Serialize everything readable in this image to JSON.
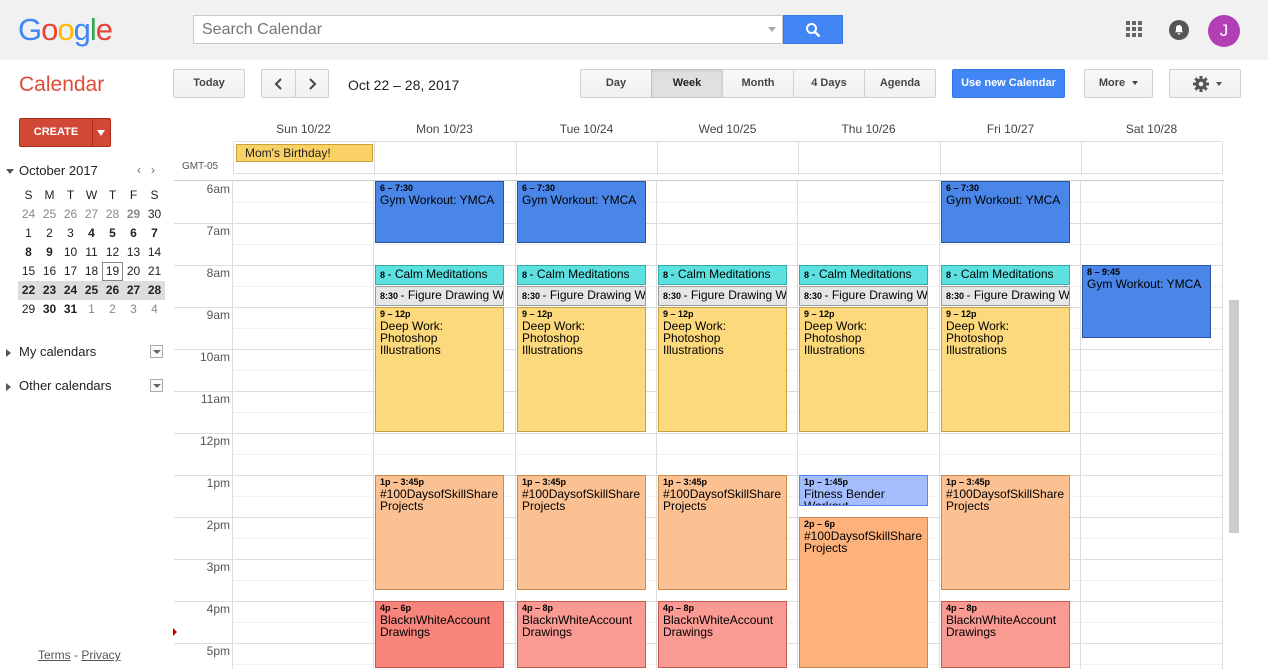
{
  "header": {
    "logo": [
      "G",
      "o",
      "o",
      "g",
      "l",
      "e"
    ],
    "logo_colors": [
      "#4285f4",
      "#ea4335",
      "#fbbc05",
      "#4285f4",
      "#34a853",
      "#ea4335"
    ],
    "search_placeholder": "Search Calendar",
    "avatar_letter": "J"
  },
  "toolbar": {
    "app_title": "Calendar",
    "today": "Today",
    "date_range": "Oct 22 – 28, 2017",
    "views": [
      "Day",
      "Week",
      "Month",
      "4 Days",
      "Agenda"
    ],
    "active_view": "Week",
    "new_calendar": "Use new Calendar",
    "more": "More"
  },
  "sidebar": {
    "create": "CREATE",
    "month_title": "October 2017",
    "weekdays": [
      "S",
      "M",
      "T",
      "W",
      "T",
      "F",
      "S"
    ],
    "weeks": [
      [
        "24",
        "25",
        "26",
        "27",
        "28",
        "29",
        "30"
      ],
      [
        "1",
        "2",
        "3",
        "4",
        "5",
        "6",
        "7"
      ],
      [
        "8",
        "9",
        "10",
        "11",
        "12",
        "13",
        "14"
      ],
      [
        "15",
        "16",
        "17",
        "18",
        "19",
        "20",
        "21"
      ],
      [
        "22",
        "23",
        "24",
        "25",
        "26",
        "27",
        "28"
      ],
      [
        "29",
        "30",
        "31",
        "1",
        "2",
        "3",
        "4"
      ]
    ],
    "my_calendars": "My calendars",
    "other_calendars": "Other calendars",
    "terms": "Terms",
    "privacy": "Privacy"
  },
  "calendar": {
    "timezone": "GMT-05",
    "days": [
      "Sun 10/22",
      "Mon 10/23",
      "Tue 10/24",
      "Wed 10/25",
      "Thu 10/26",
      "Fri 10/27",
      "Sat 10/28"
    ],
    "hours": [
      "6am",
      "7am",
      "8am",
      "9am",
      "10am",
      "11am",
      "12pm",
      "1pm",
      "2pm",
      "3pm",
      "4pm",
      "5pm"
    ],
    "all_day": [
      {
        "day": 0,
        "title": "Mom's Birthday!",
        "color": "#fad165"
      }
    ],
    "events": [
      {
        "day": 1,
        "start": 6,
        "end": 7.5,
        "time": "6 – 7:30",
        "title": "Gym Workout: YMCA",
        "bg": "#4986e7",
        "border": "#2952a3",
        "fg": "#000"
      },
      {
        "day": 2,
        "start": 6,
        "end": 7.5,
        "time": "6 – 7:30",
        "title": "Gym Workout: YMCA",
        "bg": "#4986e7",
        "border": "#2952a3",
        "fg": "#000"
      },
      {
        "day": 5,
        "start": 6,
        "end": 7.5,
        "time": "6 – 7:30",
        "title": "Gym Workout: YMCA",
        "bg": "#4986e7",
        "border": "#2952a3",
        "fg": "#000"
      },
      {
        "day": 1,
        "start": 8,
        "end": 8.5,
        "time": "8",
        "title": "- Calm Meditations",
        "bg": "#5ce0e0",
        "border": "#3aa",
        "fg": "#000",
        "one": true
      },
      {
        "day": 2,
        "start": 8,
        "end": 8.5,
        "time": "8",
        "title": "- Calm Meditations",
        "bg": "#5ce0e0",
        "border": "#3aa",
        "fg": "#000",
        "one": true
      },
      {
        "day": 3,
        "start": 8,
        "end": 8.5,
        "time": "8",
        "title": "- Calm Meditations",
        "bg": "#5ce0e0",
        "border": "#3aa",
        "fg": "#000",
        "one": true
      },
      {
        "day": 4,
        "start": 8,
        "end": 8.5,
        "time": "8",
        "title": "- Calm Meditations",
        "bg": "#5ce0e0",
        "border": "#3aa",
        "fg": "#000",
        "one": true
      },
      {
        "day": 5,
        "start": 8,
        "end": 8.5,
        "time": "8",
        "title": "- Calm Meditations",
        "bg": "#5ce0e0",
        "border": "#3aa",
        "fg": "#000",
        "one": true
      },
      {
        "day": 6,
        "start": 8,
        "end": 9.75,
        "time": "8 – 9:45",
        "title": "Gym Workout: YMCA",
        "bg": "#4986e7",
        "border": "#2952a3",
        "fg": "#000"
      },
      {
        "day": 1,
        "start": 8.5,
        "end": 9,
        "time": "8:30",
        "title": "- Figure Drawing Workshop",
        "bg": "#e6e6e6",
        "border": "#999",
        "fg": "#000",
        "one": true
      },
      {
        "day": 2,
        "start": 8.5,
        "end": 9,
        "time": "8:30",
        "title": "- Figure Drawing Workshop",
        "bg": "#e6e6e6",
        "border": "#999",
        "fg": "#000",
        "one": true
      },
      {
        "day": 3,
        "start": 8.5,
        "end": 9,
        "time": "8:30",
        "title": "- Figure Drawing Workshop",
        "bg": "#e6e6e6",
        "border": "#999",
        "fg": "#000",
        "one": true
      },
      {
        "day": 4,
        "start": 8.5,
        "end": 9,
        "time": "8:30",
        "title": "- Figure Drawing Workshop",
        "bg": "#e6e6e6",
        "border": "#999",
        "fg": "#000",
        "one": true
      },
      {
        "day": 5,
        "start": 8.5,
        "end": 9,
        "time": "8:30",
        "title": "- Figure Drawing Workshop",
        "bg": "#e6e6e6",
        "border": "#999",
        "fg": "#000",
        "one": true
      },
      {
        "day": 1,
        "start": 9,
        "end": 12,
        "time": "9 – 12p",
        "title": "Deep Work: Photoshop Illustrations",
        "bg": "#fbd97c",
        "border": "#c9a13a",
        "fg": "#000"
      },
      {
        "day": 2,
        "start": 9,
        "end": 12,
        "time": "9 – 12p",
        "title": "Deep Work: Photoshop Illustrations",
        "bg": "#fbd97c",
        "border": "#c9a13a",
        "fg": "#000"
      },
      {
        "day": 3,
        "start": 9,
        "end": 12,
        "time": "9 – 12p",
        "title": "Deep Work: Photoshop Illustrations",
        "bg": "#fbd97c",
        "border": "#c9a13a",
        "fg": "#000"
      },
      {
        "day": 4,
        "start": 9,
        "end": 12,
        "time": "9 – 12p",
        "title": "Deep Work: Photoshop Illustrations",
        "bg": "#fbd97c",
        "border": "#c9a13a",
        "fg": "#000"
      },
      {
        "day": 5,
        "start": 9,
        "end": 12,
        "time": "9 – 12p",
        "title": "Deep Work: Photoshop Illustrations",
        "bg": "#fbd97c",
        "border": "#c9a13a",
        "fg": "#000"
      },
      {
        "day": 1,
        "start": 13,
        "end": 15.75,
        "time": "1p – 3:45p",
        "title": "#100DaysofSkillShare Projects",
        "bg": "#fcc193",
        "border": "#c98a4a",
        "fg": "#000"
      },
      {
        "day": 2,
        "start": 13,
        "end": 15.75,
        "time": "1p – 3:45p",
        "title": "#100DaysofSkillShare Projects",
        "bg": "#fcc193",
        "border": "#c98a4a",
        "fg": "#000"
      },
      {
        "day": 3,
        "start": 13,
        "end": 15.75,
        "time": "1p – 3:45p",
        "title": "#100DaysofSkillShare Projects",
        "bg": "#fcc193",
        "border": "#c98a4a",
        "fg": "#000"
      },
      {
        "day": 4,
        "start": 13,
        "end": 13.75,
        "time": "1p – 1:45p",
        "title": "Fitness Bender Workout",
        "bg": "#a4bdfc",
        "border": "#5484ed",
        "fg": "#000"
      },
      {
        "day": 5,
        "start": 13,
        "end": 15.75,
        "time": "1p – 3:45p",
        "title": "#100DaysofSkillShare Projects",
        "bg": "#fcc193",
        "border": "#c98a4a",
        "fg": "#000"
      },
      {
        "day": 4,
        "start": 14,
        "end": 18,
        "time": "2p – 6p",
        "title": "#100DaysofSkillShare Projects",
        "bg": "#fdb27b",
        "border": "#c98a4a",
        "fg": "#000"
      },
      {
        "day": 1,
        "start": 16,
        "end": 18,
        "time": "4p – 6p",
        "title": "BlacknWhiteAccount Drawings",
        "bg": "#f7857c",
        "border": "#c9574c",
        "fg": "#000"
      },
      {
        "day": 2,
        "start": 16,
        "end": 20,
        "time": "4p – 8p",
        "title": "BlacknWhiteAccount Drawings",
        "bg": "#f99a93",
        "border": "#c9574c",
        "fg": "#000"
      },
      {
        "day": 3,
        "start": 16,
        "end": 20,
        "time": "4p – 8p",
        "title": "BlacknWhiteAccount Drawings",
        "bg": "#f99a93",
        "border": "#c9574c",
        "fg": "#000"
      },
      {
        "day": 5,
        "start": 16,
        "end": 20,
        "time": "4p – 8p",
        "title": "BlacknWhiteAccount Drawings",
        "bg": "#f99a93",
        "border": "#c9574c",
        "fg": "#000"
      }
    ]
  }
}
